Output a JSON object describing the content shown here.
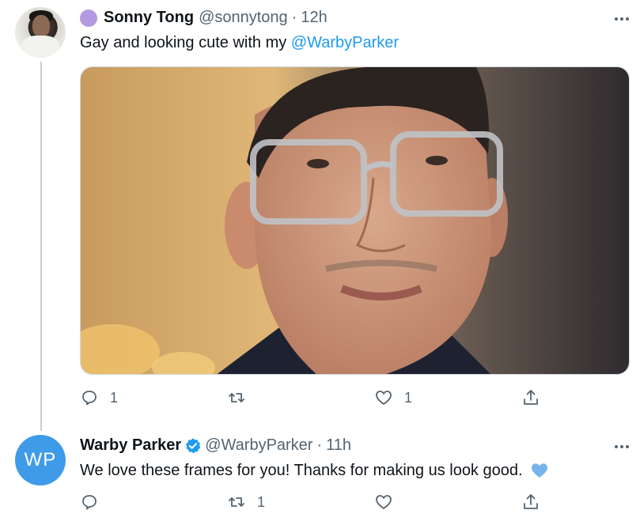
{
  "tweet1": {
    "name": "Sonny Tong",
    "handle": "@sonnytong",
    "separator": "·",
    "time": "12h",
    "text_prefix": "Gay and looking cute with my ",
    "mention": "@WarbyParker",
    "actions": {
      "reply_count": "1",
      "retweet_count": "",
      "like_count": "1"
    }
  },
  "tweet2": {
    "name": "Warby Parker",
    "handle": "@WarbyParker",
    "separator": "·",
    "time": "11h",
    "avatar_initials": "WP",
    "text": "We love these frames for you! Thanks for making us look good.",
    "actions": {
      "reply_count": "",
      "retweet_count": "1",
      "like_count": ""
    }
  },
  "colors": {
    "accent": "#1d9bf0",
    "muted": "#536471",
    "wp_avatar": "#3f9be8",
    "heart_emoji": "#78b4ec"
  },
  "icons": [
    "reply-icon",
    "retweet-icon",
    "like-icon",
    "share-icon",
    "more-icon",
    "verified-badge-icon",
    "blue-heart-emoji"
  ]
}
